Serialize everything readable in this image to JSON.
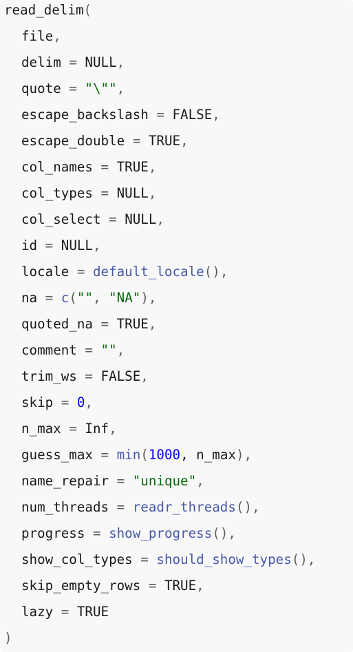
{
  "language": "R",
  "function_name": "read_delim",
  "open_paren": "(",
  "close_paren": ")",
  "colors": {
    "background": "#f8f8f8",
    "text": "#1a1a1a",
    "function_call": "#4758ab",
    "string": "#036a07",
    "number": "#0000ff",
    "operator": "#5e5e5e"
  },
  "args": [
    {
      "name": "file"
    },
    {
      "name": "delim",
      "value": "NULL"
    },
    {
      "name": "quote",
      "value": "\"\\\"\"",
      "vtype": "str"
    },
    {
      "name": "escape_backslash",
      "value": "FALSE"
    },
    {
      "name": "escape_double",
      "value": "TRUE"
    },
    {
      "name": "col_names",
      "value": "TRUE"
    },
    {
      "name": "col_types",
      "value": "NULL"
    },
    {
      "name": "col_select",
      "value": "NULL"
    },
    {
      "name": "id",
      "value": "NULL"
    },
    {
      "name": "locale",
      "fn": "default_locale",
      "fn_args": "()"
    },
    {
      "name": "na",
      "fn": "c",
      "fn_open": "(",
      "str1": "\"\"",
      "sep": ", ",
      "str2": "\"NA\"",
      "fn_close": ")"
    },
    {
      "name": "quoted_na",
      "value": "TRUE"
    },
    {
      "name": "comment",
      "value": "\"\"",
      "vtype": "str"
    },
    {
      "name": "trim_ws",
      "value": "FALSE"
    },
    {
      "name": "skip",
      "value": "0",
      "vtype": "num"
    },
    {
      "name": "n_max",
      "value": "Inf"
    },
    {
      "name": "guess_max",
      "fn": "min",
      "fn_open": "(",
      "num": "1000",
      "rest": ", n_max",
      "fn_close": ")"
    },
    {
      "name": "name_repair",
      "value": "\"unique\"",
      "vtype": "str"
    },
    {
      "name": "num_threads",
      "fn": "readr_threads",
      "fn_args": "()"
    },
    {
      "name": "progress",
      "fn": "show_progress",
      "fn_args": "()"
    },
    {
      "name": "show_col_types",
      "fn": "should_show_types",
      "fn_args": "()"
    },
    {
      "name": "skip_empty_rows",
      "value": "TRUE"
    },
    {
      "name": "lazy",
      "value": "TRUE",
      "last": true
    }
  ]
}
